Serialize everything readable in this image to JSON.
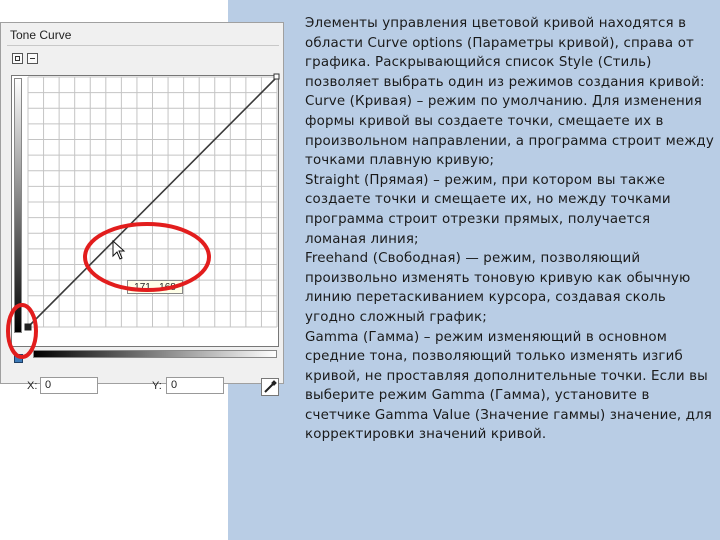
{
  "window": {
    "title": "Tone Curve",
    "x_label": "X:",
    "x_value": "0",
    "y_label": "Y:",
    "y_value": "0",
    "tooltip": "171 , 168"
  },
  "icons": [
    "expand-icon",
    "collapse-icon",
    "eyedropper-icon",
    "cursor-arrow-icon",
    "point-marker-icon"
  ],
  "colors": {
    "panel_bg": "#b9cde5",
    "highlight_ring": "#e21d1d"
  },
  "text": "Элементы управления цветовой кривой находятся в области Curve options (Параметры кривой), справа от графика. Раскрывающийся список Style (Стиль) позволяет выбрать один из режимов создания кривой:\nCurve (Кривая) – режим по умолчанию. Для изменения формы кривой вы создаете точки, смещаете их в произвольном направлении, а программа строит между точками плавную кривую;\nStraight (Прямая) – режим, при котором вы также создаете точки и смещаете их, но между точками программа строит отрезки прямых, получается ломаная линия;\nFreehand (Свободная) — режим, позволяющий произвольно изменять тоновую кривую как обычную линию перетаскиванием курсора, создавая сколь угодно сложный график;\nGamma (Гамма) – режим изменяющий в основном средние тона, позволяющий только изменять изгиб кривой, не проставляя дополнительные точки. Если вы выберите режим Gamma (Гамма), установите в счетчике Gamma Value (Значение гаммы) значение, для корректировки значений кривой."
}
